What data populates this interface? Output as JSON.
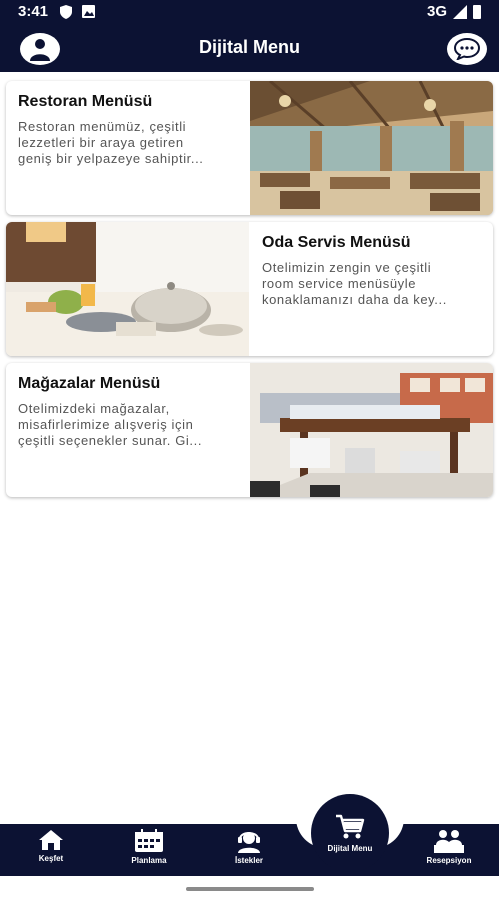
{
  "status_bar": {
    "time": "3:41",
    "network": "3G"
  },
  "app_bar": {
    "title": "Dijital Menu"
  },
  "cards": [
    {
      "title": "Restoran Menüsü",
      "description": "Restoran menümüz, çeşitli lezzetleri bir araya getiren geniş bir yelpazeye sahiptir..."
    },
    {
      "title": "Oda Servis Menüsü",
      "description": "Otelimizin zengin ve çeşitli room service menüsüyle konaklamanızı daha da key..."
    },
    {
      "title": "Mağazalar Menüsü",
      "description": "Otelimizdeki mağazalar, misafirlerimize alışveriş için çeşitli seçenekler sunar. Gi..."
    }
  ],
  "bottom_nav": {
    "items": [
      {
        "label": "Keşfet",
        "icon": "house-icon"
      },
      {
        "label": "Planlama",
        "icon": "calendar-icon"
      },
      {
        "label": "İstekler",
        "icon": "support-agent-icon"
      },
      {
        "label": "Resepsiyon",
        "icon": "reception-icon"
      }
    ],
    "active": {
      "label": "Dijital Menu",
      "icon": "cart-icon"
    }
  },
  "colors": {
    "primary": "#0c1233",
    "background": "#ffffff",
    "text": "#111111",
    "muted": "#555555"
  }
}
